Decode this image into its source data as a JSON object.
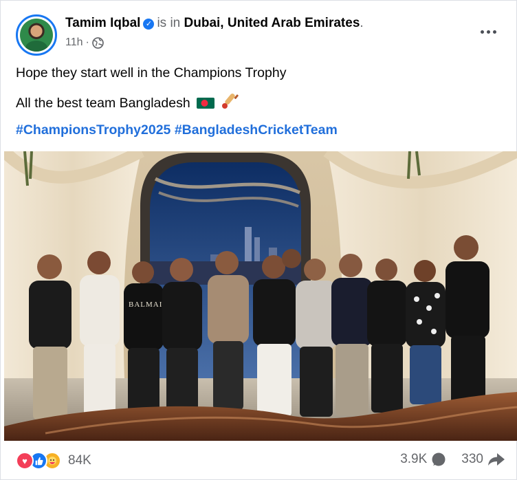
{
  "post": {
    "author": "Tamim Iqbal",
    "verified_icon": "verified-badge-icon",
    "is_in": "is in",
    "location": "Dubai, United Arab Emirates",
    "period": ".",
    "time": "11h",
    "separator": "·",
    "privacy_icon": "globe-icon",
    "text_line_1": "Hope they start well in the Champions Trophy",
    "text_line_2": "All the best team Bangladesh",
    "text_line_2_emojis": [
      "bangladesh-flag",
      "cricket-bat"
    ],
    "hashtags": [
      "#ChampionsTrophy2025",
      "#BangladeshCricketTeam"
    ],
    "photo_label": "team-group-photo",
    "photo_visible_text": "BALMAIN"
  },
  "footer": {
    "reaction_icons": [
      "love-icon",
      "like-icon",
      "care-icon"
    ],
    "reaction_count": "84K",
    "comment_count": "3.9K",
    "share_count": "330"
  },
  "colors": {
    "accent": "#1877f2",
    "hashtag": "#216fdb",
    "muted": "#65676b",
    "love": "#f33e58",
    "care": "#f7b125"
  }
}
